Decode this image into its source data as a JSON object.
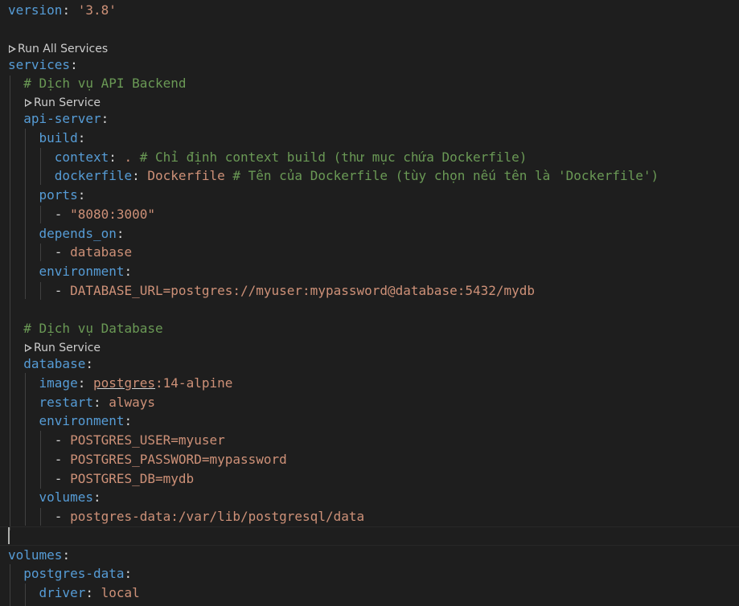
{
  "codelens": {
    "run_all": "Run All Services",
    "run_api": "Run Service",
    "run_db": "Run Service"
  },
  "code": {
    "version_key": "version",
    "version_val": "'3.8'",
    "services_key": "services",
    "comment_api": "# Dịch vụ API Backend",
    "api_key": "api-server",
    "build_key": "build",
    "context_key": "context",
    "context_val": ".",
    "context_comment": "# Chỉ định context build (thư mục chứa Dockerfile)",
    "dockerfile_key": "dockerfile",
    "dockerfile_val": "Dockerfile",
    "dockerfile_comment": "# Tên của Dockerfile (tùy chọn nếu tên là 'Dockerfile')",
    "ports_key": "ports",
    "ports_item": "\"8080:3000\"",
    "depends_key": "depends_on",
    "depends_item": "database",
    "env_key": "environment",
    "env_item": "DATABASE_URL=postgres://myuser:mypassword@database:5432/mydb",
    "comment_db": "# Dịch vụ Database",
    "database_key": "database",
    "image_key": "image",
    "image_val_a": "postgres",
    "image_val_b": ":14-alpine",
    "restart_key": "restart",
    "restart_val": "always",
    "env2_key": "environment",
    "env2_items": [
      "POSTGRES_USER=myuser",
      "POSTGRES_PASSWORD=mypassword",
      "POSTGRES_DB=mydb"
    ],
    "volumes_key": "volumes",
    "volumes_item": "postgres-data:/var/lib/postgresql/data",
    "root_volumes_key": "volumes",
    "pgdata_key": "postgres-data",
    "driver_key": "driver",
    "driver_val": "local"
  }
}
